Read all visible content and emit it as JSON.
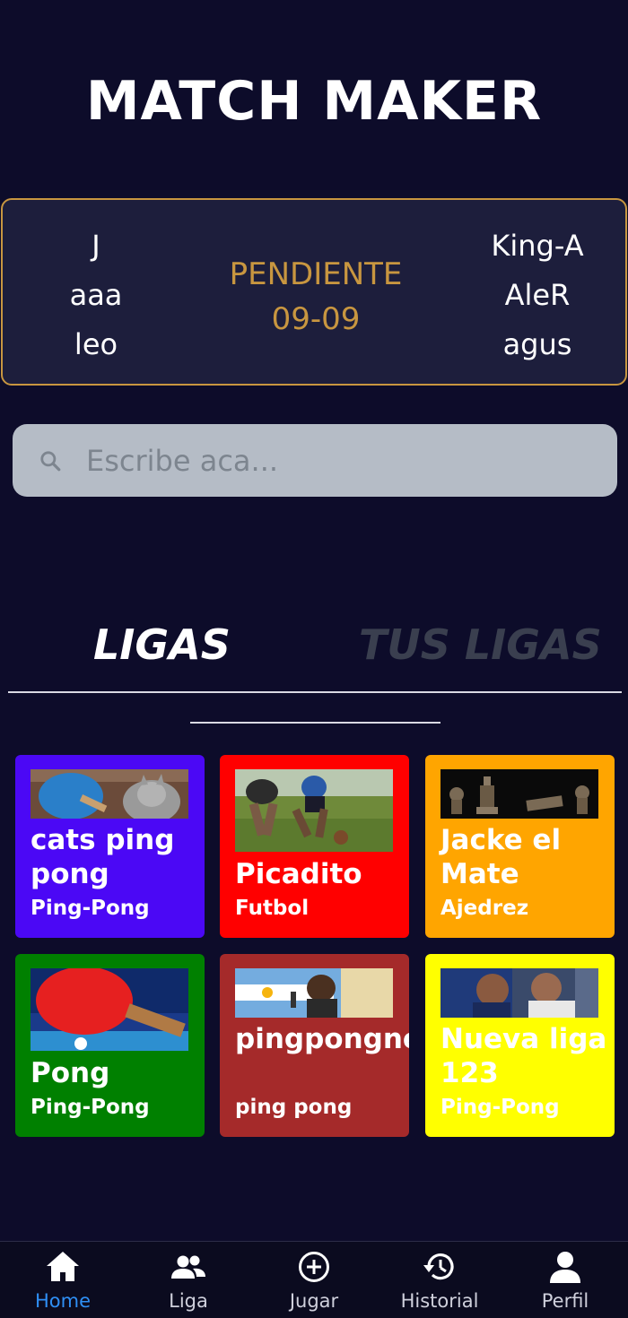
{
  "app": {
    "title": "MATCH MAKER"
  },
  "match": {
    "team_left": [
      "J",
      "aaa",
      "leo"
    ],
    "status": "PENDIENTE",
    "date": "09-09",
    "team_right": [
      "King-A",
      "AleR",
      "agus"
    ]
  },
  "search": {
    "placeholder": "Escribe aca..."
  },
  "tabs": [
    {
      "label": "LIGAS",
      "active": true
    },
    {
      "label": "TUS LIGAS",
      "active": false
    }
  ],
  "leagues": [
    {
      "name": "cats ping pong",
      "sport": "Ping-Pong",
      "color": "#4b08f5",
      "image": "cat-ping-pong-photo"
    },
    {
      "name": "Picadito",
      "sport": "Futbol",
      "color": "#ff0000",
      "image": "football-kids-photo"
    },
    {
      "name": "Jacke el Mate",
      "sport": "Ajedrez",
      "color": "#ffa500",
      "image": "chess-pieces-photo"
    },
    {
      "name": "Pong",
      "sport": "Ping-Pong",
      "color": "#008000",
      "image": "ping-pong-paddle-photo"
    },
    {
      "name": "pingpongneando",
      "sport": "ping pong",
      "color": "#a52a2a",
      "image": "argentina-flag-photo"
    },
    {
      "name": "Nueva liga 123",
      "sport": "Ping-Pong",
      "color": "#ffff00",
      "image": "football-players-photo"
    }
  ],
  "nav": [
    {
      "label": "Home",
      "icon": "home-icon",
      "active": true
    },
    {
      "label": "Liga",
      "icon": "group-icon",
      "active": false
    },
    {
      "label": "Jugar",
      "icon": "add-circle-icon",
      "active": false
    },
    {
      "label": "Historial",
      "icon": "history-icon",
      "active": false
    },
    {
      "label": "Perfil",
      "icon": "person-icon",
      "active": false
    }
  ],
  "colors": {
    "background": "#0d0c2a",
    "accent_gold": "#c89640",
    "nav_active": "#2f8ff5"
  }
}
